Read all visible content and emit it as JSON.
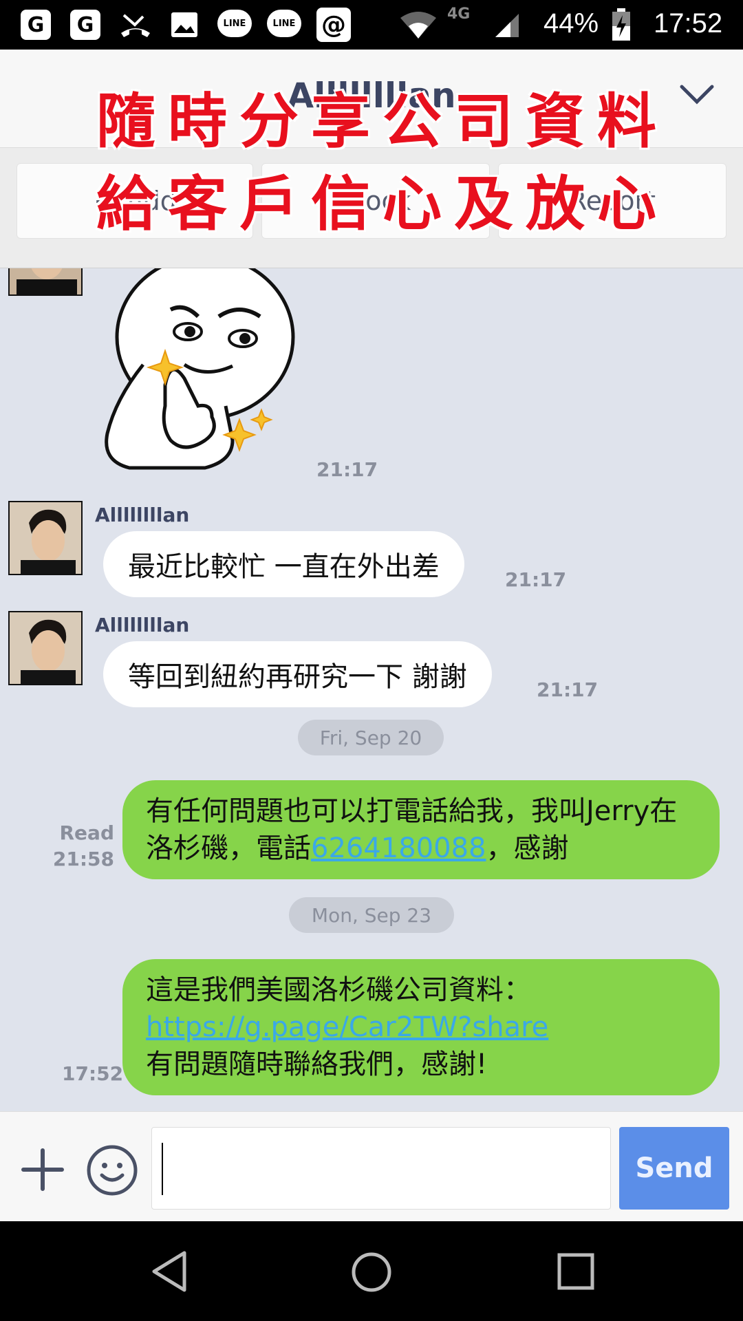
{
  "status_bar": {
    "notif_g1": "G",
    "notif_g2": "G",
    "notif_line1": "LINE",
    "notif_line2": "LINE",
    "notif_at": "@",
    "network": "4G",
    "battery": "44%",
    "time": "17:52"
  },
  "header": {
    "title": "Allllllllan"
  },
  "actions": {
    "add": "Add",
    "block": "Block",
    "report": "Report"
  },
  "overlay": {
    "line1": "隨時分享公司資料",
    "line2": "給客戶信心及放心"
  },
  "messages": {
    "sticker_time": "21:17",
    "msg1": {
      "sender": "Allllllllan",
      "text": "最近比較忙 一直在外出差",
      "time": "21:17"
    },
    "msg2": {
      "sender": "Allllllllan",
      "text": "等回到紐約再研究一下 謝謝",
      "time": "21:17"
    },
    "date1": "Fri, Sep 20",
    "msg3": {
      "text_part1": "有任何問題也可以打電話給我，我叫Jerry在洛杉磯，電話",
      "phone": "6264180088",
      "text_part2": "，感謝",
      "read_label": "Read",
      "time": "21:58"
    },
    "date2": "Mon, Sep 23",
    "msg4": {
      "line1": "這是我們美國洛杉磯公司資料：",
      "link": "https://g.page/Car2TW?share",
      "line3": "有問題隨時聯絡我們，感謝!",
      "time": "17:52"
    }
  },
  "input": {
    "value": "",
    "send_label": "Send"
  },
  "colors": {
    "outgoing_bubble": "#86d44a",
    "chat_background": "#dfe3ec",
    "send_button": "#5b8ee8",
    "overlay_red": "#e8101e",
    "link": "#3aa8e8"
  }
}
